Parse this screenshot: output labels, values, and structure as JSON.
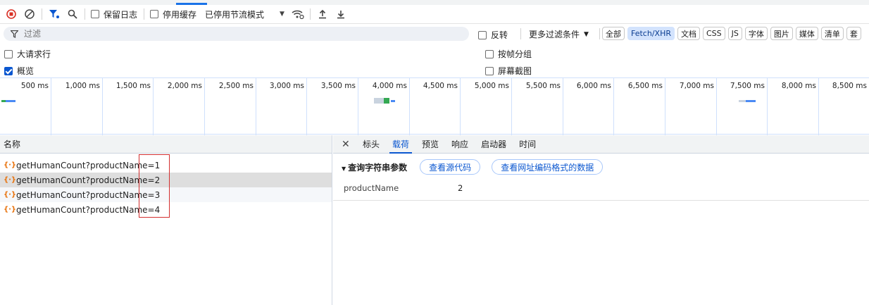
{
  "toolbar": {
    "preserve_log_label": "保留日志",
    "disable_cache_label": "停用缓存",
    "throttle_value": "已停用节流模式"
  },
  "filter": {
    "placeholder": "过滤",
    "invert_label": "反转",
    "more_filters_label": "更多过滤条件",
    "chips": [
      "全部",
      "Fetch/XHR",
      "文档",
      "CSS",
      "JS",
      "字体",
      "图片",
      "媒体",
      "清单",
      "套"
    ]
  },
  "options": {
    "big_rows": "大请求行",
    "group_by_frame": "按帧分组",
    "overview": "概览",
    "screenshots": "屏幕截图"
  },
  "timeline": {
    "ticks": [
      "500 ms",
      "1,000 ms",
      "1,500 ms",
      "2,000 ms",
      "2,500 ms",
      "3,000 ms",
      "3,500 ms",
      "4,000 ms",
      "4,500 ms",
      "5,000 ms",
      "5,500 ms",
      "6,000 ms",
      "6,500 ms",
      "7,000 ms",
      "7,500 ms",
      "8,000 ms",
      "8,500 ms"
    ]
  },
  "requests": {
    "column_name": "名称",
    "items": [
      "getHumanCount?productName=1",
      "getHumanCount?productName=2",
      "getHumanCount?productName=3",
      "getHumanCount?productName=4"
    ]
  },
  "details": {
    "tabs": [
      "标头",
      "载荷",
      "预览",
      "响应",
      "启动器",
      "时间"
    ],
    "active_tab": "载荷",
    "section_title": "查询字符串参数",
    "view_source_label": "查看源代码",
    "view_url_encoded_label": "查看网址编码格式的数据",
    "param_key": "productName",
    "param_value": "2"
  },
  "colors": {
    "accent": "#0b57d0",
    "record_red": "#d93025",
    "highlight_box": "#d32f2f",
    "xhr_orange": "#e8710a"
  },
  "icons": [
    "record-stop-icon",
    "clear-icon",
    "filter-icon",
    "search-icon",
    "wifi-settings-icon",
    "upload-icon",
    "download-icon",
    "close-icon",
    "xhr-icon"
  ]
}
